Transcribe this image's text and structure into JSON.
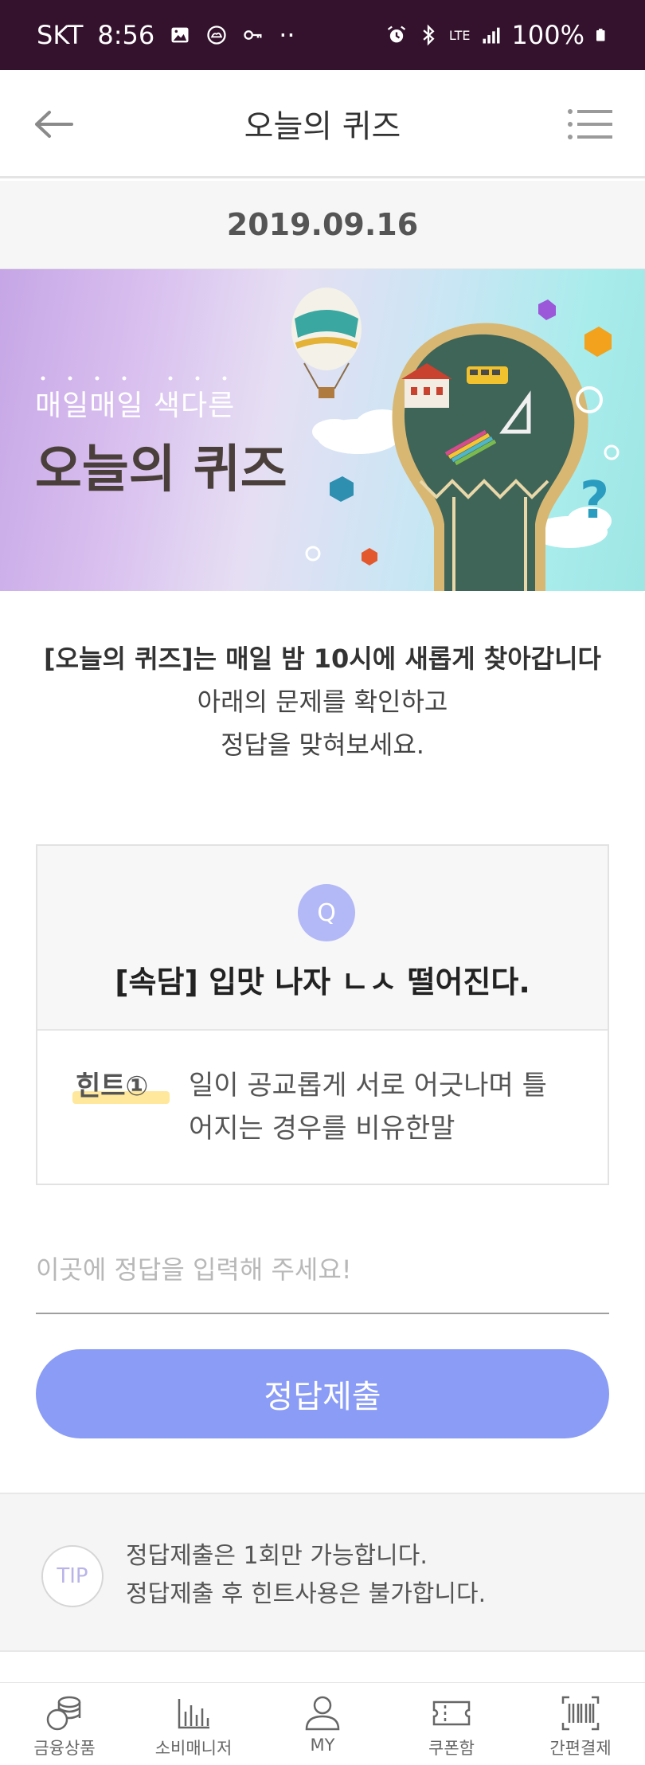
{
  "status_bar": {
    "carrier": "SKT",
    "time": "8:56",
    "dots": "··",
    "network": "LTE",
    "battery": "100%"
  },
  "header": {
    "title": "오늘의 퀴즈"
  },
  "date": "2019.09.16",
  "banner": {
    "subtitle": "매일매일 색다른",
    "title": "오늘의 퀴즈"
  },
  "intro": {
    "line1": "[오늘의 퀴즈]는 매일 밤 10시에 새롭게 찾아갑니다",
    "line2": "아래의 문제를 확인하고",
    "line3": "정답을 맞혀보세요."
  },
  "quiz": {
    "badge": "Q",
    "question": "[속담] 입맛 나자 ㄴㅅ 떨어진다.",
    "hint_label": "힌트①",
    "hint_text": "일이 공교롭게 서로 어긋나며 틀어지는 경우를 비유한말"
  },
  "answer": {
    "placeholder": "이곳에 정답을 입력해 주세요!"
  },
  "submit": {
    "label": "정답제출"
  },
  "tip": {
    "badge": "TIP",
    "line1": "정답제출은 1회만 가능합니다.",
    "line2": "정답제출 후 힌트사용은 불가합니다."
  },
  "bottom_nav": {
    "items": [
      {
        "label": "금융상품",
        "icon": "coins-icon"
      },
      {
        "label": "소비매니저",
        "icon": "bar-chart-icon"
      },
      {
        "label": "MY",
        "icon": "user-icon"
      },
      {
        "label": "쿠폰함",
        "icon": "ticket-icon"
      },
      {
        "label": "간편결제",
        "icon": "barcode-icon"
      }
    ]
  },
  "colors": {
    "status_bar_bg": "#34122d",
    "accent_button": "#8a9cf5",
    "q_badge": "#b3b9f6",
    "hint_highlight": "#ffe48a"
  }
}
